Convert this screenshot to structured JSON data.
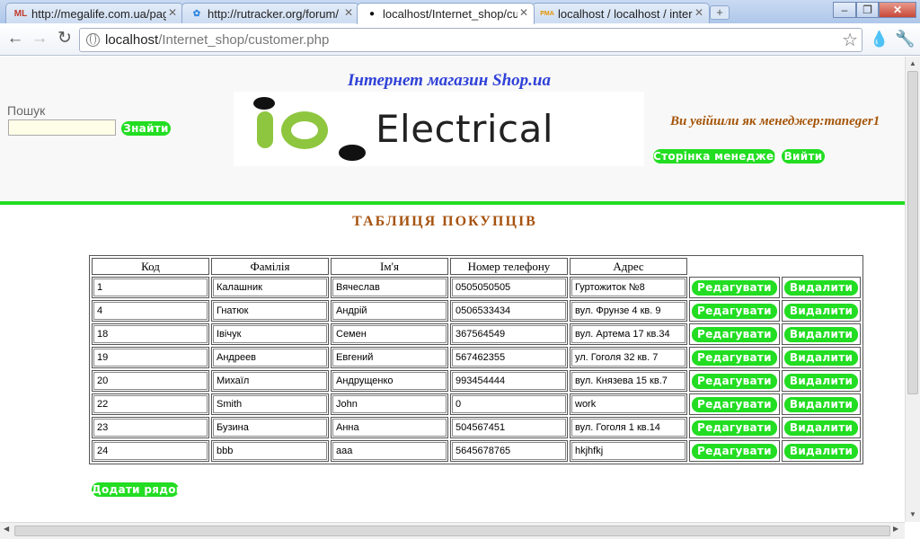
{
  "browser": {
    "tabs": [
      {
        "label": "http://megalife.com.ua/pag",
        "favicon": "ML",
        "active": false
      },
      {
        "label": "http://rutracker.org/forum/",
        "favicon": "✿",
        "active": false
      },
      {
        "label": "localhost/Internet_shop/cus",
        "favicon": "●",
        "active": true
      },
      {
        "label": "localhost / localhost / interr",
        "favicon": "PMA",
        "active": false
      }
    ],
    "url_host": "localhost",
    "url_path": "/Internet_shop/customer.php"
  },
  "header": {
    "site_title": "Інтернет магазин Shop.ua",
    "search_label": "Пошук",
    "search_value": "",
    "search_button": "Знайти",
    "logo_text": "Electrical",
    "manager_message": "Ви увійшли як менеджер:maneger1",
    "manager_page_button": "Сторінка менеджера",
    "logout_button": "Вийти"
  },
  "main": {
    "title": "ТАБЛИЦЯ ПОКУПЦІВ",
    "columns": [
      "Код",
      "Фамілія",
      "Ім'я",
      "Номер телефону",
      "Адрес"
    ],
    "edit_label": "Редагувати",
    "delete_label": "Видалити",
    "rows": [
      [
        "1",
        "Калашник",
        "Вячеслав",
        "0505050505",
        "Гуртожиток №8"
      ],
      [
        "4",
        "Гнатюк",
        "Андрій",
        "0506533434",
        "вул. Фрунзе 4 кв. 9"
      ],
      [
        "18",
        "Івічук",
        "Семен",
        "367564549",
        "вул. Артема 17 кв.34"
      ],
      [
        "19",
        "Андреев",
        "Евгений",
        "567462355",
        "ул. Гоголя 32 кв. 7"
      ],
      [
        "20",
        "Михаїл",
        "Андрущенко",
        "993454444",
        "вул. Князева 15 кв.7"
      ],
      [
        "22",
        "Smith",
        "John",
        "0",
        "work"
      ],
      [
        "23",
        "Бузина",
        "Анна",
        "504567451",
        "вул. Гоголя 1 кв.14"
      ],
      [
        "24",
        "bbb",
        "aaa",
        "5645678765",
        "hkjhfkj"
      ]
    ],
    "add_row_button": "Додати рядок"
  },
  "colors": {
    "accent_green": "#22dd22",
    "title_blue": "#2f41d8",
    "brown": "#a6520e"
  }
}
